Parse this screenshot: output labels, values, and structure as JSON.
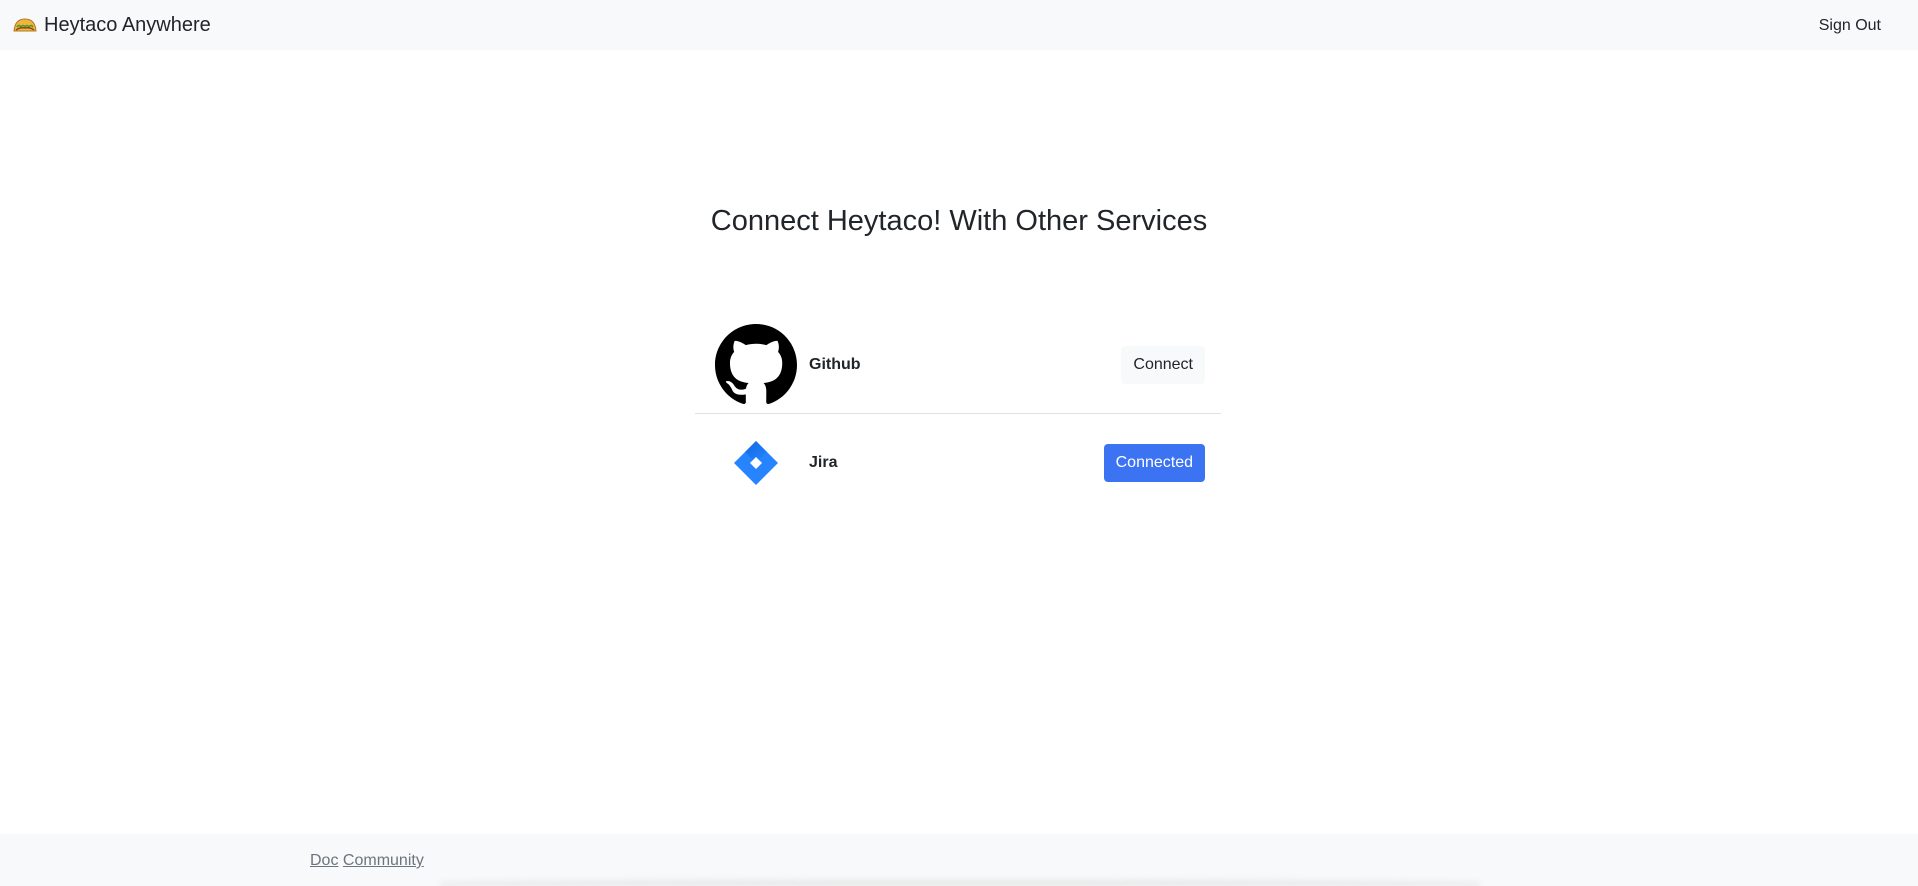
{
  "navbar": {
    "brand_label": "Heytaco Anywhere",
    "brand_icon": "taco-icon",
    "signout_label": "Sign Out"
  },
  "main": {
    "heading": "Connect Heytaco! With Other Services",
    "services": [
      {
        "name": "Github",
        "icon": "github-icon",
        "button_label": "Connect",
        "status": "not-connected"
      },
      {
        "name": "Jira",
        "icon": "jira-icon",
        "button_label": "Connected",
        "status": "connected"
      }
    ]
  },
  "footer": {
    "links": [
      "Doc",
      "Community"
    ]
  },
  "colors": {
    "navbar_bg": "#f8f9fa",
    "primary": "#3b73f2",
    "text": "#212529",
    "muted": "#6c757d",
    "jira_blue": "#2684ff"
  }
}
